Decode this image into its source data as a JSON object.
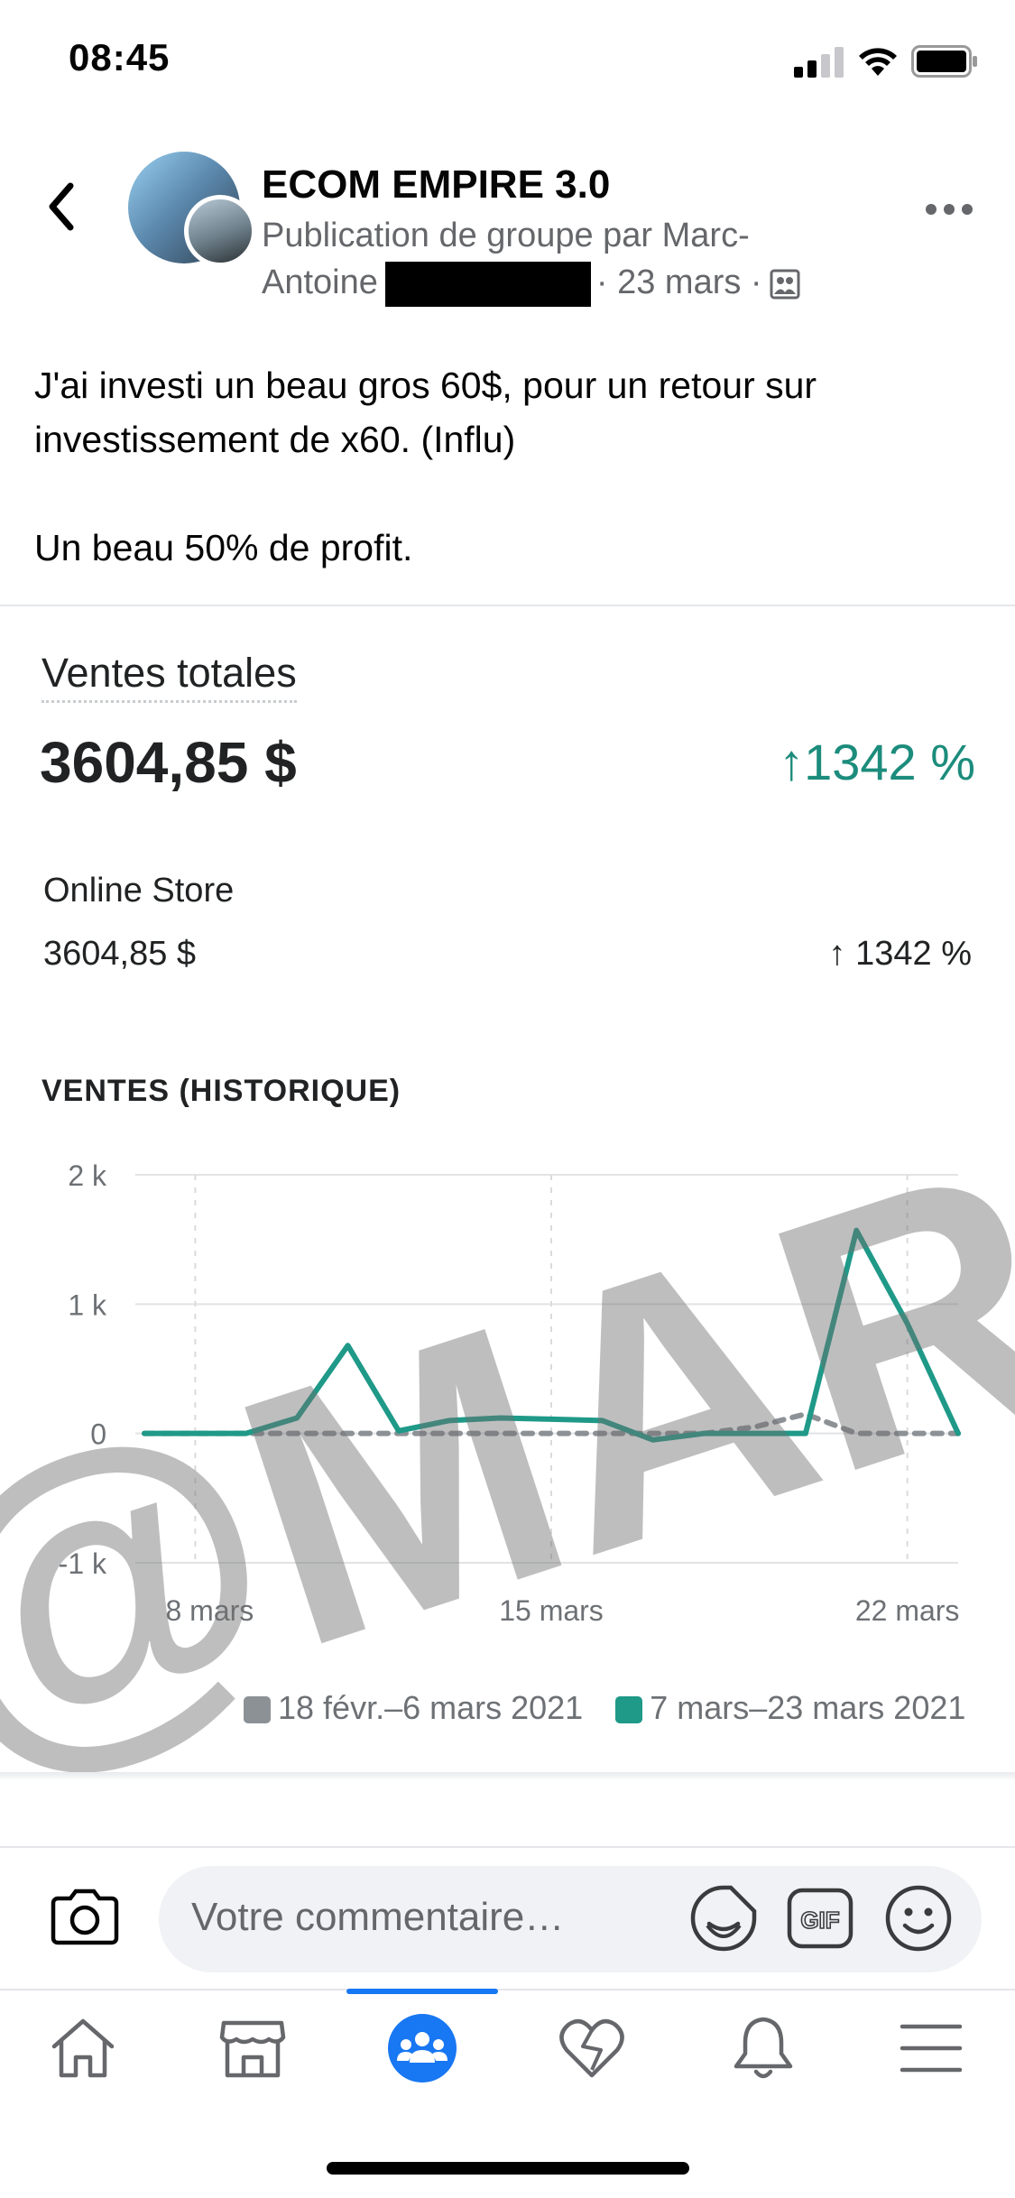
{
  "status_bar": {
    "time": "08:45"
  },
  "post_header": {
    "group_name": "ECOM EMPIRE 3.0",
    "meta_line1": "Publication de groupe par Marc-",
    "meta_author_first": "Antoine",
    "meta_date": "· 23 mars ·"
  },
  "post": {
    "line1": "J'ai investi un beau gros 60$, pour un retour sur",
    "line2": "investissement de x60. (Influ)",
    "line3": "Un beau 50% de profit."
  },
  "stats": {
    "title": "Ventes totales",
    "value": "3604,85 $",
    "change": "↑1342 %",
    "store_label": "Online Store",
    "store_value": "3604,85 $",
    "store_change": "↑ 1342 %",
    "chart_title": "VENTES (HISTORIQUE)",
    "watermark": "@MARC"
  },
  "chart_data": {
    "type": "line",
    "title": "VENTES (HISTORIQUE)",
    "xlabel": "",
    "ylabel": "",
    "ylim": [
      -1000,
      2000
    ],
    "y_ticks": [
      2000,
      1000,
      0,
      -1000
    ],
    "y_tick_labels": [
      "2 k",
      "1 k",
      "0",
      "-1 k"
    ],
    "x_tick_labels": [
      "8 mars",
      "15 mars",
      "22 mars"
    ],
    "x_tick_days": [
      8,
      15,
      22
    ],
    "x": [
      7,
      8,
      9,
      10,
      11,
      12,
      13,
      14,
      15,
      16,
      17,
      18,
      19,
      20,
      21,
      22,
      23
    ],
    "series": [
      {
        "name": "18 févr.–6 mars 2021",
        "color": "#8c9196",
        "dashed": true,
        "values": [
          0,
          0,
          0,
          0,
          0,
          0,
          0,
          0,
          0,
          0,
          0,
          0,
          50,
          150,
          0,
          0,
          0
        ]
      },
      {
        "name": "7 mars–23 mars 2021",
        "color": "#1f9988",
        "dashed": false,
        "values": [
          0,
          0,
          0,
          120,
          680,
          20,
          100,
          120,
          110,
          100,
          -50,
          0,
          0,
          0,
          1570,
          850,
          0
        ]
      }
    ],
    "grid": true,
    "legend_position": "bottom"
  },
  "comment_bar": {
    "placeholder": "Votre commentaire…"
  },
  "icons": {
    "back": "back-chevron-icon",
    "more": "more-dots-icon",
    "camera": "camera-icon",
    "sticker": "sticker-icon",
    "gif": "gif-icon",
    "emoji": "emoji-icon",
    "tabs": [
      "home-icon",
      "marketplace-icon",
      "groups-icon",
      "dating-heart-icon",
      "notifications-bell-icon",
      "menu-icon"
    ]
  },
  "colors": {
    "accent": "#1877f2",
    "teal": "#1f9988",
    "muted": "#65676b"
  }
}
